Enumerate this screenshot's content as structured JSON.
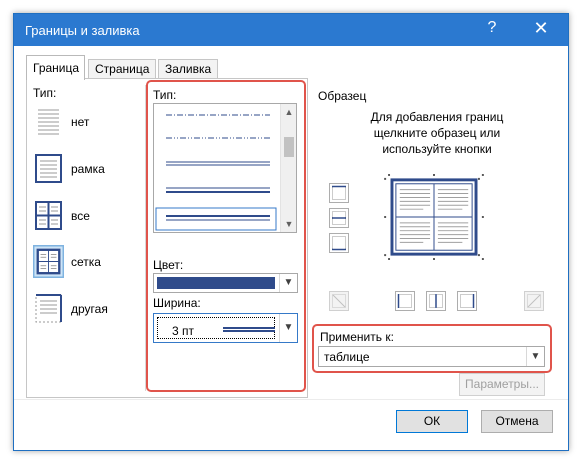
{
  "dialog": {
    "title": "Границы и заливка",
    "help": "?",
    "close": "✕"
  },
  "tabs": [
    {
      "label": "Граница",
      "active": true
    },
    {
      "label": "Страница",
      "active": false
    },
    {
      "label": "Заливка",
      "active": false
    }
  ],
  "setting": {
    "label": "Тип:",
    "items": [
      {
        "label": "нет",
        "icon": "border-none-icon",
        "selected": false
      },
      {
        "label": "рамка",
        "icon": "border-box-icon",
        "selected": false
      },
      {
        "label": "все",
        "icon": "border-all-icon",
        "selected": false
      },
      {
        "label": "сетка",
        "icon": "border-grid-icon",
        "selected": true
      },
      {
        "label": "другая",
        "icon": "border-custom-icon",
        "selected": false
      }
    ]
  },
  "style": {
    "label": "Тип:",
    "options": [
      "dash-dot",
      "dash-dot-dot",
      "double",
      "thin-thick",
      "thick-thin"
    ],
    "selected": "thick-thin"
  },
  "color": {
    "label": "Цвет:",
    "value": "#2f4b8b"
  },
  "width": {
    "label": "Ширина:",
    "value": "3 пт"
  },
  "preview": {
    "label": "Образец",
    "hint": "Для добавления границ щелкните образец или используйте кнопки"
  },
  "apply": {
    "label": "Применить к:",
    "value": "таблице"
  },
  "buttons": {
    "options": "Параметры...",
    "ok": "ОК",
    "cancel": "Отмена"
  },
  "colors": {
    "titlebar": "#2b79d0",
    "highlight": "#e0544b",
    "border_line": "#2f4b8b"
  }
}
